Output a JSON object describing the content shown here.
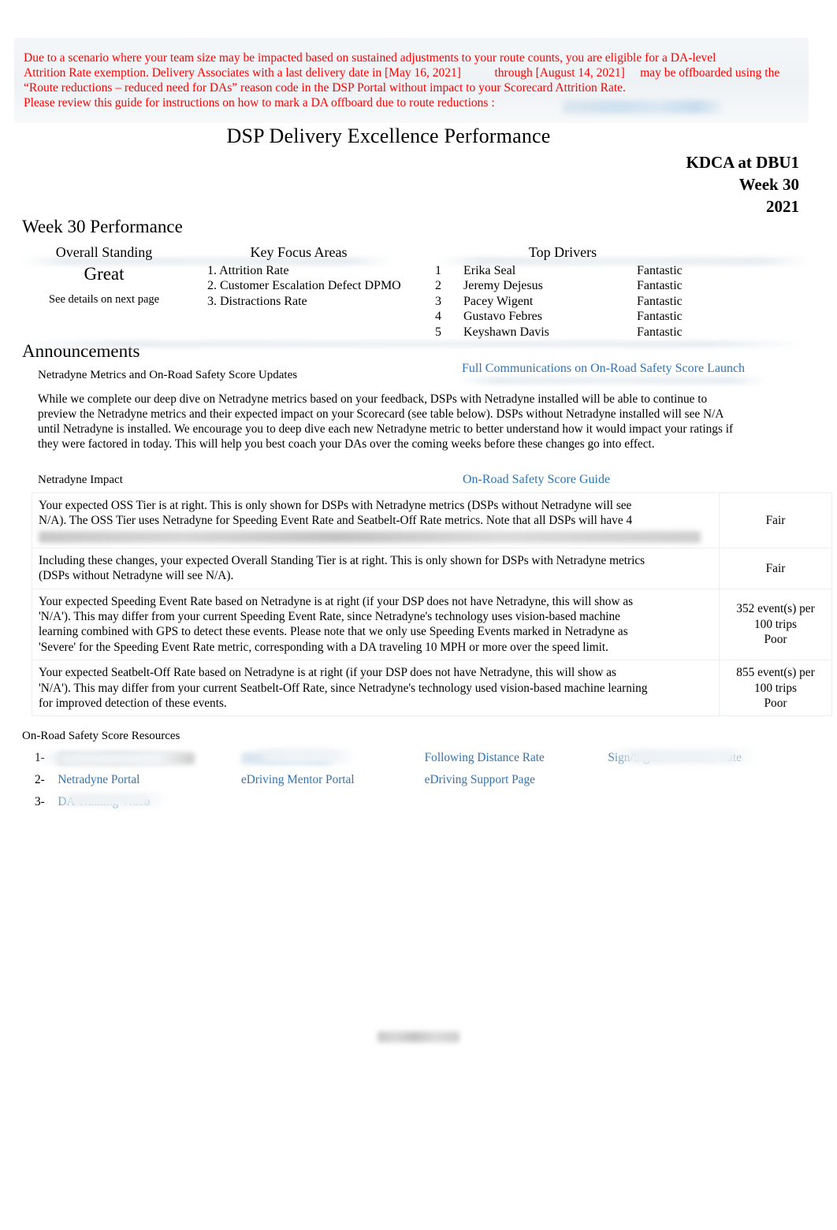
{
  "notice": {
    "line1": "Due to a scenario where your team size may be impacted based on sustained adjustments to your route counts, you are eligible for a DA-level",
    "line2": "Attrition Rate exemption. Delivery Associates with a last delivery date in [May 16, 2021]           through [August 14, 2021]     may be offboarded using the",
    "line3": "“Route reductions – reduced need for DAs” reason code in the DSP Portal without impact to your Scorecard Attrition Rate.",
    "line4": "Please review this guide for instructions on how to mark a DA offboard due to route reductions :",
    "color": "#FF0000"
  },
  "header": {
    "title": "DSP Delivery Excellence Performance",
    "station": "KDCA at DBU1",
    "week": "Week 30",
    "year": "2021"
  },
  "week_performance": {
    "heading": "Week 30 Performance",
    "overall_standing": {
      "title": "Overall Standing",
      "value": "Great",
      "note": "See details on next page"
    },
    "key_focus_areas": {
      "title": "Key Focus Areas",
      "items": [
        "1. Attrition Rate",
        "2. Customer Escalation Defect DPMO",
        "3. Distractions Rate"
      ]
    },
    "top_drivers": {
      "title": "Top Drivers",
      "rows": [
        {
          "rank": "1",
          "name": "Erika Seal",
          "score": "Fantastic"
        },
        {
          "rank": "2",
          "name": "Jeremy Dejesus",
          "score": "Fantastic"
        },
        {
          "rank": "3",
          "name": "Pacey Wigent",
          "score": "Fantastic"
        },
        {
          "rank": "4",
          "name": "Gustavo Febres",
          "score": "Fantastic"
        },
        {
          "rank": "5",
          "name": "Keyshawn Davis",
          "score": "Fantastic"
        }
      ]
    }
  },
  "announcements": {
    "heading": "Announcements",
    "subtitle": "Netradyne Metrics and On-Road Safety Score Updates",
    "link_label": "Full Communications on On-Road Safety Score Launch",
    "body": [
      "While we complete our deep dive on Netradyne metrics based on your feedback, DSPs with Netradyne installed will be able to continue to",
      "preview the Netradyne metrics and their expected impact on your Scorecard (see table below). DSPs without Netradyne installed will see N/A",
      "until Netradyne is installed. We encourage you to deep dive each new Netradyne metric to better understand how it would impact your ratings if",
      "they were factored in today. This will help you best coach your DAs over the coming weeks before these changes go into effect."
    ]
  },
  "netradyne_impact": {
    "label": "Netradyne Impact",
    "link_label": "On-Road Safety Score Guide",
    "rows": [
      {
        "name": "oss-tier",
        "lines": [
          "Your expected    OSS Tier   is at right. This is only shown for DSPs with Netradyne metrics (DSPs without Netradyne will see",
          "N/A). The OSS Tier uses Netradyne for Speeding Event Rate and Seatbelt-Off Rate metrics. Note that all DSPs will have 4"
        ],
        "blurred_line": true,
        "value": [
          "Fair"
        ]
      },
      {
        "name": "overall-standing-tier",
        "lines": [
          "Including these changes, your expected          Overall Standing Tier      is at right. This is only shown for DSPs with Netradyne metrics",
          "(DSPs without Netradyne will see N/A)."
        ],
        "blurred_line": false,
        "value": [
          "Fair"
        ]
      },
      {
        "name": "speeding-event-rate",
        "lines": [
          "Your expected    Speeding Event Rate       based on Netradyne is at right (if your DSP does not have Netradyne, this will show as",
          "'N/A'). This may differ from your current Speeding Event Rate, since Netradyne's technology uses vision-based machine",
          "learning combined with GPS to detect these events. Please note that we only use Speeding Events marked in Netradyne as",
          "'Severe' for the Speeding Event Rate metric, corresponding with a DA traveling 10 MPH or more over the speed limit."
        ],
        "blurred_line": false,
        "value": [
          "352 event(s) per",
          "100 trips",
          "Poor"
        ]
      },
      {
        "name": "seatbelt-off-rate",
        "lines": [
          "Your expected    Seatbelt-Off Rate      based on Netradyne is at right (if your DSP does not have Netradyne, this will show as",
          "'N/A'). This may differ from your current Seatbelt-Off Rate, since Netradyne's technology used vision-based machine learning",
          "for improved detection of these events."
        ],
        "blurred_line": false,
        "value": [
          "855 event(s) per",
          "100 trips",
          "Poor"
        ]
      }
    ]
  },
  "resources": {
    "label": "On-Road Safety Score Resources",
    "rows": [
      {
        "num": "1-",
        "cells": [
          {
            "type": "blurred-text"
          },
          {
            "type": "blurred-link"
          },
          {
            "type": "link",
            "label": "Following Distance Rate"
          },
          {
            "type": "link",
            "label": "Sign/Signal Violations Rate"
          }
        ]
      },
      {
        "num": "2-",
        "cells": [
          {
            "type": "link",
            "label": "Netradyne Portal"
          },
          {
            "type": "link",
            "label": "eDriving Mentor Portal"
          },
          {
            "type": "link",
            "label": "eDriving Support Page"
          },
          {
            "type": "empty"
          }
        ]
      },
      {
        "num": "3-",
        "cells": [
          {
            "type": "link",
            "label": "DA Training Video"
          },
          {
            "type": "empty"
          },
          {
            "type": "empty"
          },
          {
            "type": "empty"
          }
        ]
      }
    ]
  },
  "footer": {
    "blurred": true
  },
  "colors": {
    "link": "#2E74B5",
    "notice": "#FF0000",
    "band": "#EEF2F5",
    "table_border": "#ECEFF1"
  }
}
